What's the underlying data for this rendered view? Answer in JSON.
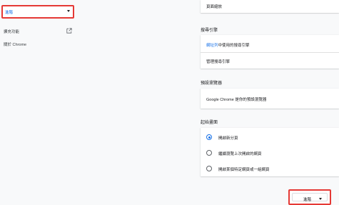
{
  "sidebar": {
    "section_select": {
      "value": "進階"
    },
    "items": [
      {
        "label": "擴充功能"
      },
      {
        "label": "關於 Chrome"
      }
    ]
  },
  "appearance": {
    "page_zoom_label": "頁面縮放"
  },
  "search_engine": {
    "title": "搜尋引擎",
    "address_bar_link": "網址列",
    "address_bar_rest": "中使用的搜尋引擎",
    "manage_label": "管理搜尋引擎"
  },
  "default_browser": {
    "title": "預設瀏覽器",
    "status": "Google Chrome 是你的預設瀏覽器"
  },
  "on_startup": {
    "title": "起始畫面",
    "options": [
      {
        "label": "開啟新分頁",
        "selected": true
      },
      {
        "label": "繼續瀏覽上次開啟的網頁",
        "selected": false
      },
      {
        "label": "開啟某個特定網頁或一組網頁",
        "selected": false
      }
    ]
  },
  "advanced_button": {
    "label": "進階"
  },
  "colors": {
    "accent": "#1a73e8",
    "highlight_border": "#e53935",
    "background": "#f8f9fa"
  }
}
